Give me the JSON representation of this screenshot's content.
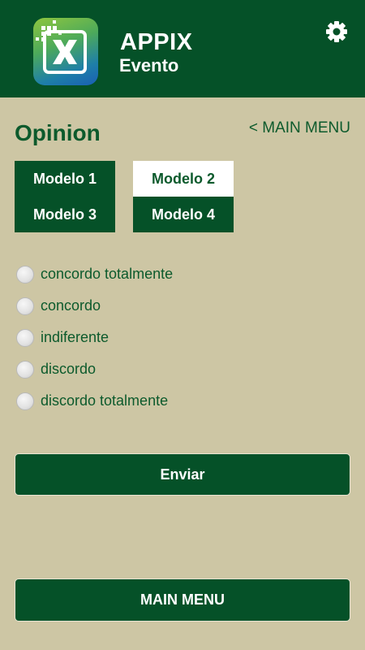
{
  "header": {
    "title": "APPIX",
    "subtitle": "Evento",
    "logo_icon": "appix-x-logo-icon",
    "settings_icon": "gear-icon"
  },
  "page": {
    "title": "Opinion",
    "main_menu_link": "< MAIN MENU"
  },
  "models": [
    {
      "label": "Modelo 1",
      "selected": false
    },
    {
      "label": "Modelo 2",
      "selected": true
    },
    {
      "label": "Modelo 3",
      "selected": false
    },
    {
      "label": "Modelo 4",
      "selected": false
    }
  ],
  "options": [
    {
      "label": "concordo totalmente",
      "checked": false
    },
    {
      "label": "concordo",
      "checked": false
    },
    {
      "label": "indiferente",
      "checked": false
    },
    {
      "label": "discordo",
      "checked": false
    },
    {
      "label": "discordo totalmente",
      "checked": false
    }
  ],
  "buttons": {
    "submit": "Enviar",
    "main_menu": "MAIN MENU"
  },
  "colors": {
    "primary": "#055128",
    "background": "#cdc6a4",
    "text": "#0c5a2c",
    "selected_bg": "#ffffff"
  }
}
